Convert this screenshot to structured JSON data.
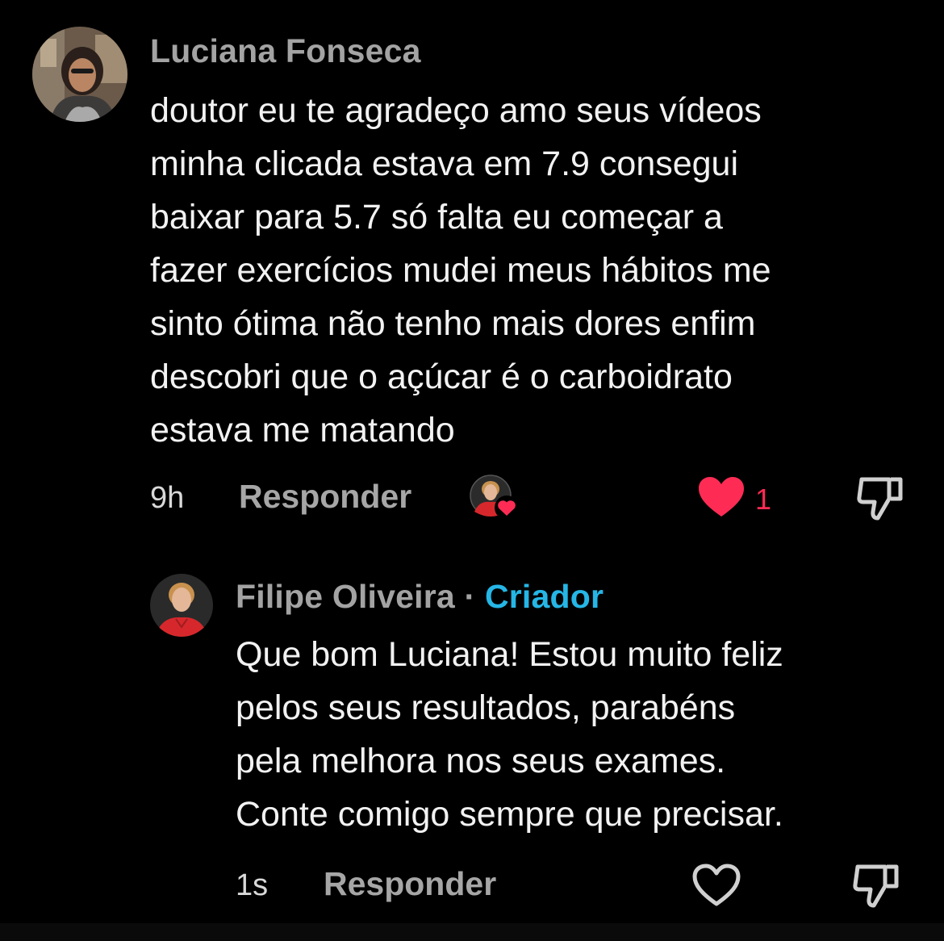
{
  "comment": {
    "author": "Luciana Fonseca",
    "text": "doutor eu te agradeço amo seus vídeos\nminha clicada estava em 7.9 consegui\nbaixar para 5.7 só falta eu começar a\nfazer exercícios mudei meus hábitos me\nsinto ótima não tenho mais dores enfim\ndescobri que o açúcar é o carboidrato\nestava me matando",
    "time": "9h",
    "reply_label": "Responder",
    "like_count": "1",
    "liked": true,
    "icons": [
      "creator-liked-avatar",
      "heart-filled-icon",
      "thumbs-down-icon"
    ]
  },
  "reply": {
    "author": "Filipe Oliveira",
    "separator": "·",
    "badge": "Criador",
    "text": "Que bom Luciana! Estou muito feliz\npelos seus resultados, parabéns\npela melhora nos seus exames.\nConte comigo sempre que precisar.",
    "time": "1s",
    "reply_label": "Responder",
    "liked": false,
    "icons": [
      "heart-outline-icon",
      "thumbs-down-icon"
    ]
  },
  "colors": {
    "background": "#000000",
    "like_red": "#fe2c55",
    "creator_blue": "#25b6e6",
    "username_gray": "#a3a3a3"
  }
}
